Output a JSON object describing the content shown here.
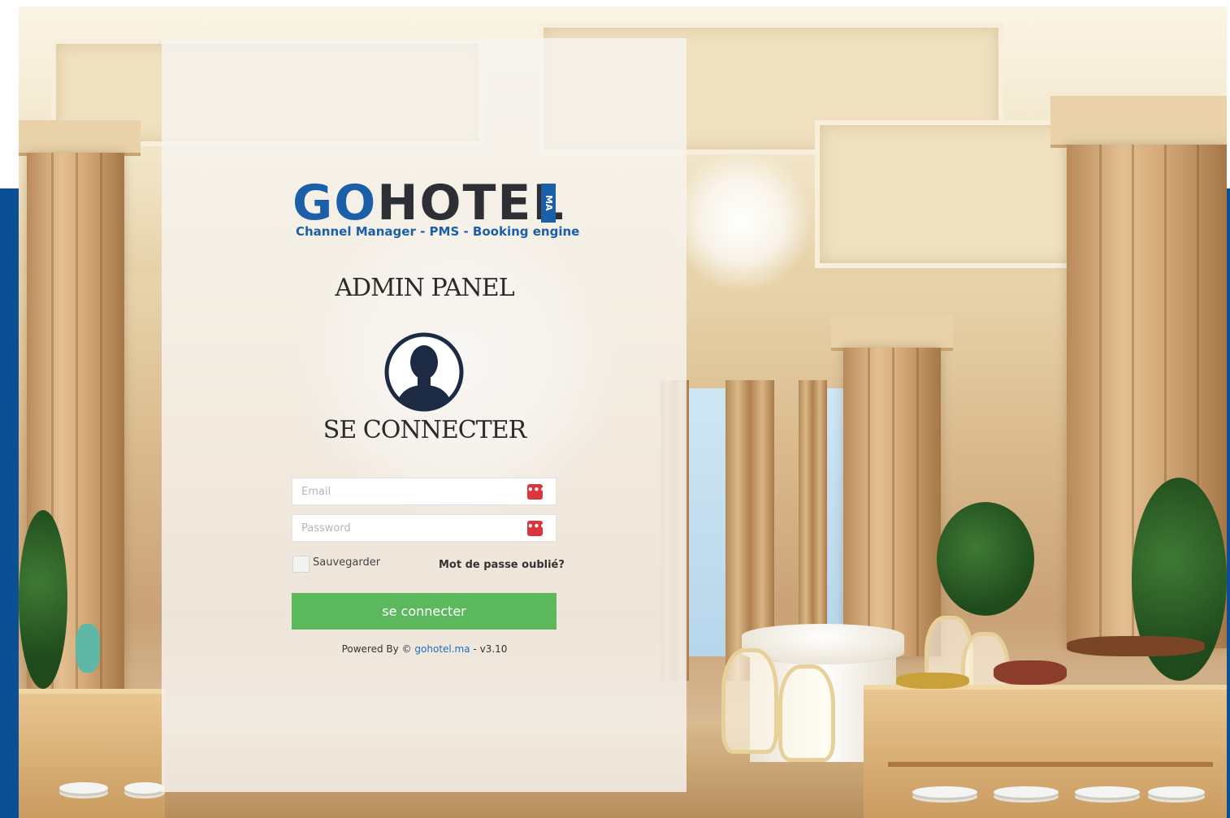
{
  "brand": {
    "logo_text_go": "GO",
    "logo_text_hotel": "HOTEL",
    "logo_badge": "MA",
    "tagline": "Channel Manager - PMS - Booking engine",
    "colors": {
      "brand_blue": "#1b5fa8",
      "side_band": "#0b4f95",
      "submit_green": "#5cb85c",
      "field_icon_red": "#d9363e"
    }
  },
  "panel": {
    "title": "ADMIN PANEL",
    "avatar_icon": "user-silhouette-icon",
    "login_heading": "SE CONNECTER"
  },
  "form": {
    "email_placeholder": "Email",
    "password_placeholder": "Password",
    "field_icon": "ellipsis-icon",
    "field_icon_glyph": "•••",
    "remember_label": "Sauvegarder",
    "forgot_label": "Mot de passe oublié?",
    "submit_label": "se connecter"
  },
  "footer": {
    "powered_prefix": "Powered By ©",
    "powered_link": "gohotel.ma",
    "powered_suffix": "- v3.10"
  }
}
